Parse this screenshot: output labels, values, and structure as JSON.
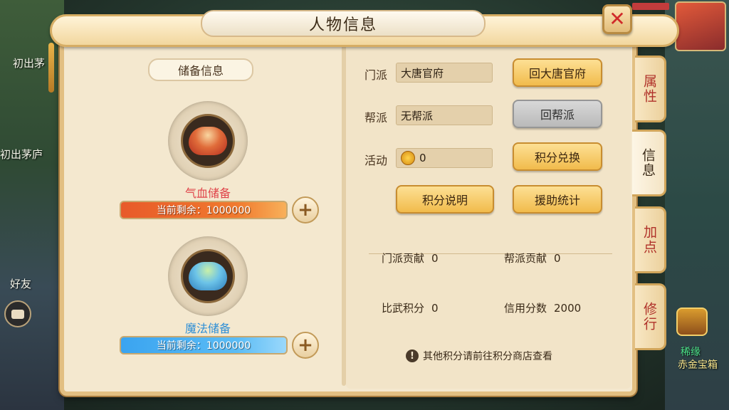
{
  "background": {
    "labels": [
      "初出茅",
      "初出茅庐",
      "好友"
    ],
    "chest_label_line1": "稀缘",
    "chest_label_line2": "赤金宝箱"
  },
  "window": {
    "title": "人物信息",
    "close_icon": "close-x-icon"
  },
  "reserve": {
    "section_title": "储备信息",
    "hp": {
      "label": "气血储备",
      "remaining_text": "当前剩余：1000000",
      "label_color": "#e0444a"
    },
    "mp": {
      "label": "魔法储备",
      "remaining_text": "当前剩余：1000000",
      "label_color": "#2f8fd6"
    }
  },
  "info": {
    "sect_label": "门派",
    "sect_value": "大唐官府",
    "guild_label": "帮派",
    "guild_value": "无帮派",
    "activity_label": "活动",
    "activity_value": "0",
    "buttons": {
      "return_sect": "回大唐官府",
      "return_guild": "回帮派",
      "points_exchange": "积分兑换",
      "points_help": "积分说明",
      "assist_stats": "援助统计"
    },
    "stats": {
      "sect_contribution_label": "门派贡献",
      "sect_contribution_value": "0",
      "guild_contribution_label": "帮派贡献",
      "guild_contribution_value": "0",
      "duel_points_label": "比武积分",
      "duel_points_value": "0",
      "credit_score_label": "信用分数",
      "credit_score_value": "2000"
    },
    "notice": "其他积分请前往积分商店查看"
  },
  "tabs": [
    {
      "label": "属性",
      "active": false
    },
    {
      "label": "信息",
      "active": true
    },
    {
      "label": "加点",
      "active": false
    },
    {
      "label": "修行",
      "active": false
    }
  ]
}
